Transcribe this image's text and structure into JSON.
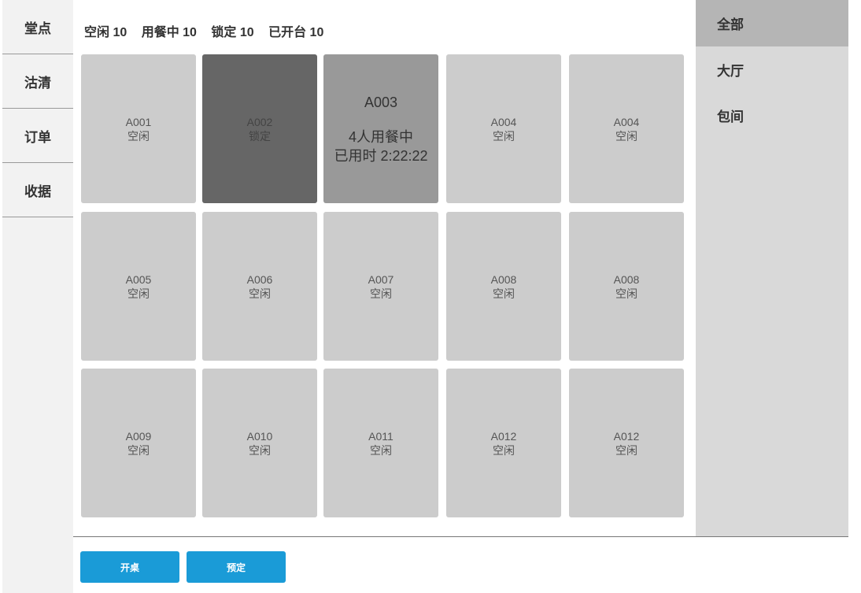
{
  "nav": {
    "items": [
      {
        "label": "堂点"
      },
      {
        "label": "沽清"
      },
      {
        "label": "订单"
      },
      {
        "label": "收据"
      }
    ]
  },
  "stats": {
    "idle": "空闲 10",
    "dining": "用餐中 10",
    "locked": "锁定 10",
    "opened": "已开台 10"
  },
  "tables": [
    {
      "name": "A001",
      "status": "空闲",
      "state": "idle"
    },
    {
      "name": "A002",
      "status": "锁定",
      "state": "locked"
    },
    {
      "name": "A003",
      "status": "4人用餐中",
      "extra": "已用时 2:22:22",
      "state": "dining"
    },
    {
      "name": "A004",
      "status": "空闲",
      "state": "idle"
    },
    {
      "name": "A004",
      "status": "空闲",
      "state": "idle"
    },
    {
      "name": "A005",
      "status": "空闲",
      "state": "idle"
    },
    {
      "name": "A006",
      "status": "空闲",
      "state": "idle"
    },
    {
      "name": "A007",
      "status": "空闲",
      "state": "idle"
    },
    {
      "name": "A008",
      "status": "空闲",
      "state": "idle"
    },
    {
      "name": "A008",
      "status": "空闲",
      "state": "idle"
    },
    {
      "name": "A009",
      "status": "空闲",
      "state": "idle"
    },
    {
      "name": "A010",
      "status": "空闲",
      "state": "idle"
    },
    {
      "name": "A011",
      "status": "空闲",
      "state": "idle"
    },
    {
      "name": "A012",
      "status": "空闲",
      "state": "idle"
    },
    {
      "name": "A012",
      "status": "空闲",
      "state": "idle"
    }
  ],
  "categories": [
    {
      "label": "全部",
      "active": true
    },
    {
      "label": "大厅",
      "active": false
    },
    {
      "label": "包间",
      "active": false
    }
  ],
  "footer": {
    "open_label": "开桌",
    "reserve_label": "预定"
  },
  "colors": {
    "accent": "#1a9bd7",
    "idle": "#cccccc",
    "locked": "#666666",
    "dining": "#999999"
  }
}
